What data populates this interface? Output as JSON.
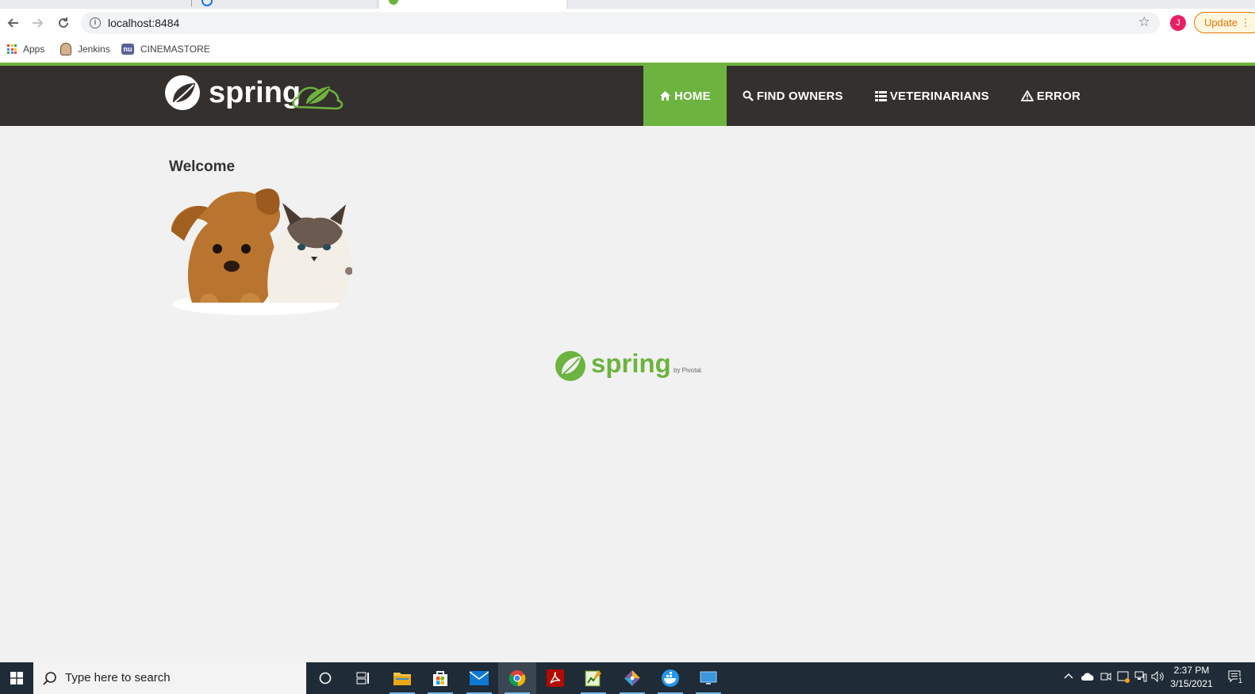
{
  "browser": {
    "url": "localhost:8484",
    "profile_initial": "J",
    "update_label": "Update",
    "bookmarks": [
      {
        "label": "Apps"
      },
      {
        "label": "Jenkins"
      },
      {
        "label": "CINEMASTORE"
      }
    ]
  },
  "app": {
    "brand_text": "spring",
    "nav": [
      {
        "label": "HOME",
        "icon": "home-icon",
        "active": true
      },
      {
        "label": "FIND OWNERS",
        "icon": "search-icon"
      },
      {
        "label": "VETERINARIANS",
        "icon": "list-icon"
      },
      {
        "label": "ERROR",
        "icon": "warning-icon"
      }
    ],
    "heading": "Welcome",
    "footer_logo_text": "spring",
    "footer_logo_by": "by Pivotal.",
    "colors": {
      "accent": "#6db33f",
      "header_bg": "#34302d",
      "page_bg": "#f1f1f1"
    }
  },
  "taskbar": {
    "search_placeholder": "Type here to search",
    "time": "2:37 PM",
    "date": "3/15/2021",
    "notification_count": "1"
  }
}
